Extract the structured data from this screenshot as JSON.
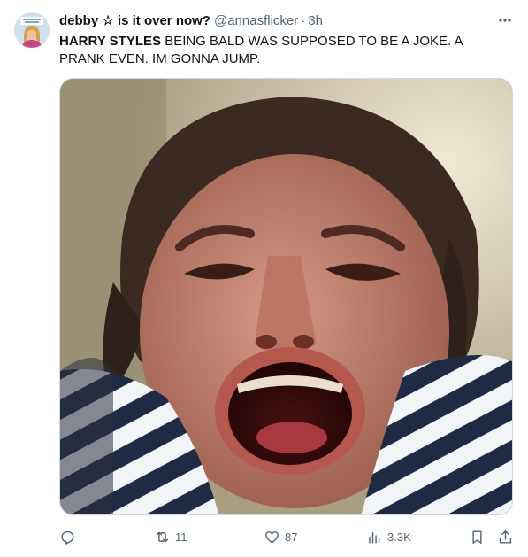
{
  "tweet": {
    "author": {
      "display_name": "debby ☆ is it over now?",
      "handle": "@annasflicker",
      "separator": "·",
      "timestamp": "3h"
    },
    "text": {
      "mention": "HARRY STYLES",
      "body": " BEING BALD WAS SUPPOSED TO BE A JOKE. A PRANK EVEN. IM GONNA JUMP."
    },
    "media": {
      "kind": "photo"
    },
    "actions": {
      "reply": {
        "icon": "reply-icon",
        "count": ""
      },
      "retweet": {
        "icon": "retweet-icon",
        "count": "11"
      },
      "like": {
        "icon": "heart-icon",
        "count": "87"
      },
      "views": {
        "icon": "views-icon",
        "count": "3.3K"
      },
      "bookmark": {
        "icon": "bookmark-icon"
      },
      "share": {
        "icon": "share-icon"
      }
    },
    "colors": {
      "text": "#0f1419",
      "secondary": "#536471",
      "border": "#cfd9de"
    }
  }
}
